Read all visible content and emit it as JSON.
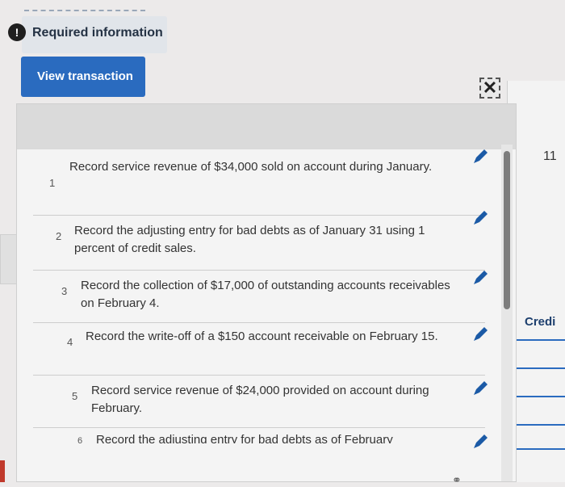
{
  "header": {
    "info_icon": "info-icon",
    "required_label": "Required information",
    "view_button_label": "View transaction list"
  },
  "dialog": {
    "close_icon": "close-icon",
    "transactions": [
      {
        "num": "1",
        "text": "Record service revenue of $34,000 sold on account during January."
      },
      {
        "num": "2",
        "text": "Record the adjusting entry for bad debts as of January 31 using 1 percent of credit sales."
      },
      {
        "num": "3",
        "text": "Record the collection of $17,000 of outstanding accounts receivables on February 4."
      },
      {
        "num": "4",
        "text": "Record the write-off of a $150 account receivable on February 15."
      },
      {
        "num": "5",
        "text": "Record service revenue of $24,000 provided on account during February."
      },
      {
        "num": "6",
        "text": "Record the adjusting entry for bad debts as of February"
      }
    ],
    "edit_icon": "pencil-icon"
  },
  "background": {
    "page_number": "11",
    "credit_header": "Credi"
  },
  "colors": {
    "accent": "#2a6bbf",
    "pencil": "#1b5aa6"
  }
}
